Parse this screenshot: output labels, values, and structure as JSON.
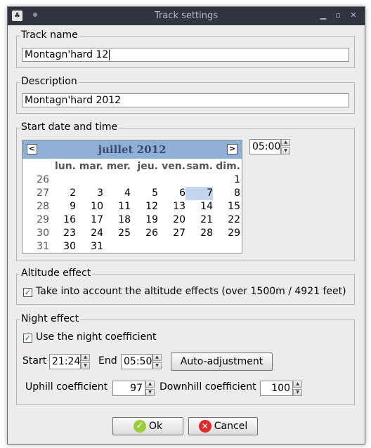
{
  "window": {
    "title": "Track settings"
  },
  "track_name": {
    "legend": "Track name",
    "value": "Montagn'hard 12"
  },
  "description": {
    "legend": "Description",
    "value": "Montagn'hard 2012"
  },
  "start": {
    "legend": "Start date and time",
    "time": "05:00",
    "calendar": {
      "month_label": "juillet 2012",
      "prev": "<",
      "next": ">",
      "days_of_week": [
        "lun.",
        "mar.",
        "mer.",
        "jeu.",
        "ven.",
        "sam.",
        "dim."
      ],
      "weeks": [
        {
          "week": "26",
          "days": [
            "",
            "",
            "",
            "",
            "",
            "",
            "1"
          ]
        },
        {
          "week": "27",
          "days": [
            "2",
            "3",
            "4",
            "5",
            "6",
            "7",
            "8"
          ]
        },
        {
          "week": "28",
          "days": [
            "9",
            "10",
            "11",
            "12",
            "13",
            "14",
            "15"
          ]
        },
        {
          "week": "29",
          "days": [
            "16",
            "17",
            "18",
            "19",
            "20",
            "21",
            "22"
          ]
        },
        {
          "week": "30",
          "days": [
            "23",
            "24",
            "25",
            "26",
            "27",
            "28",
            "29"
          ]
        },
        {
          "week": "31",
          "days": [
            "30",
            "31",
            "",
            "",
            "",
            "",
            ""
          ]
        }
      ],
      "selected_day": "7"
    }
  },
  "altitude": {
    "legend": "Altitude effect",
    "checkbox_label": "Take into account the altitude effects (over 1500m / 4921 feet)",
    "checked": true
  },
  "night": {
    "legend": "Night effect",
    "checkbox_label": "Use the night coefficient",
    "checked": true,
    "start_label": "Start",
    "start_value": "21:24",
    "end_label": "End",
    "end_value": "05:50",
    "auto_button": "Auto-adjustment",
    "uphill_label": "Uphill coefficient",
    "uphill_value": "97",
    "downhill_label": "Downhill coefficient",
    "downhill_value": "100"
  },
  "buttons": {
    "ok": "Ok",
    "cancel": "Cancel"
  },
  "icons": {
    "check": "✓",
    "ok_icon": "✓",
    "cancel_icon": "✕",
    "spin_up": "▲",
    "spin_down": "▼"
  }
}
